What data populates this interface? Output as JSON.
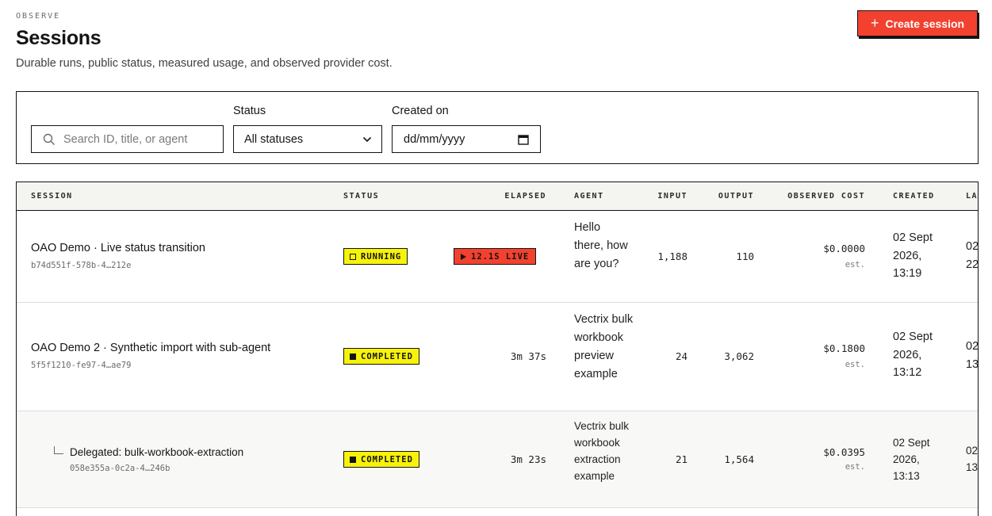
{
  "header": {
    "eyebrow": "OBSERVE",
    "title": "Sessions",
    "subtitle": "Durable runs, public status, measured usage, and observed provider cost.",
    "create_label": "Create session"
  },
  "filters": {
    "search_placeholder": "Search ID, title, or agent",
    "status_label": "Status",
    "status_value": "All statuses",
    "created_label": "Created on",
    "created_value": "dd/mm/yyyy"
  },
  "table": {
    "columns": {
      "session": "SESSION",
      "status": "STATUS",
      "elapsed": "ELAPSED",
      "agent": "AGENT",
      "input": "INPUT",
      "output": "OUTPUT",
      "cost": "OBSERVED COST",
      "created": "CREATED",
      "last": "LA"
    },
    "rows": [
      {
        "title": "OAO Demo · Live status transition",
        "id": "b74d551f-578b-4…212e",
        "status": "RUNNING",
        "elapsed": "12.1S LIVE",
        "agent": "Hello there, how are you?",
        "input": "1,188",
        "output": "110",
        "cost": "$0.0000",
        "cost_note": "est.",
        "created": "02 Sept 2026, 13:19",
        "last": "02 22"
      },
      {
        "title": "OAO Demo 2 · Synthetic import with sub-agent",
        "id": "5f5f1210-fe97-4…ae79",
        "status": "COMPLETED",
        "elapsed": "3m 37s",
        "agent": "Vectrix bulk workbook preview example",
        "input": "24",
        "output": "3,062",
        "cost": "$0.1800",
        "cost_note": "est.",
        "created": "02 Sept 2026, 13:12",
        "last": "02 13"
      },
      {
        "title": "Delegated: bulk-workbook-extraction",
        "id": "058e355a-0c2a-4…246b",
        "status": "COMPLETED",
        "elapsed": "3m 23s",
        "agent": "Vectrix bulk workbook extraction example",
        "input": "21",
        "output": "1,564",
        "cost": "$0.0395",
        "cost_note": "est.",
        "created": "02 Sept 2026, 13:13",
        "last": "02 13"
      }
    ]
  },
  "colors": {
    "accent": "#f2412f",
    "badge": "#f7f20a",
    "ink": "#141414"
  }
}
